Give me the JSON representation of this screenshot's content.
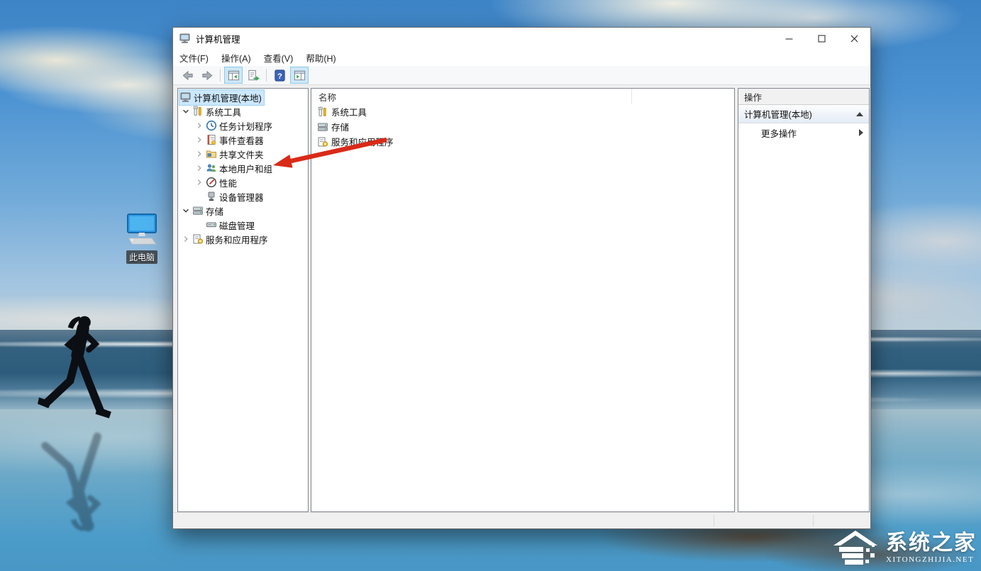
{
  "desktop": {
    "icon_label": "此电脑"
  },
  "watermark": {
    "title": "系统之家",
    "domain": "XITONGZHIJIA.NET"
  },
  "window": {
    "title": "计算机管理",
    "menu": [
      "文件(F)",
      "操作(A)",
      "查看(V)",
      "帮助(H)"
    ],
    "tree": {
      "items": [
        {
          "label": "计算机管理(本地)"
        },
        {
          "label": "系统工具"
        },
        {
          "label": "任务计划程序"
        },
        {
          "label": "事件查看器"
        },
        {
          "label": "共享文件夹"
        },
        {
          "label": "本地用户和组"
        },
        {
          "label": "性能"
        },
        {
          "label": "设备管理器"
        },
        {
          "label": "存储"
        },
        {
          "label": "磁盘管理"
        },
        {
          "label": "服务和应用程序"
        }
      ]
    },
    "list": {
      "header": "名称",
      "items": [
        {
          "label": "系统工具"
        },
        {
          "label": "存储"
        },
        {
          "label": "服务和应用程序"
        }
      ]
    },
    "actions": {
      "header": "操作",
      "group": "计算机管理(本地)",
      "more": "更多操作"
    }
  },
  "colors": {
    "selection": "#cce8ff",
    "annotation_arrow": "#d92a18",
    "toolbar_toggle_active": "#cde8f7",
    "pane_border": "#828790"
  }
}
